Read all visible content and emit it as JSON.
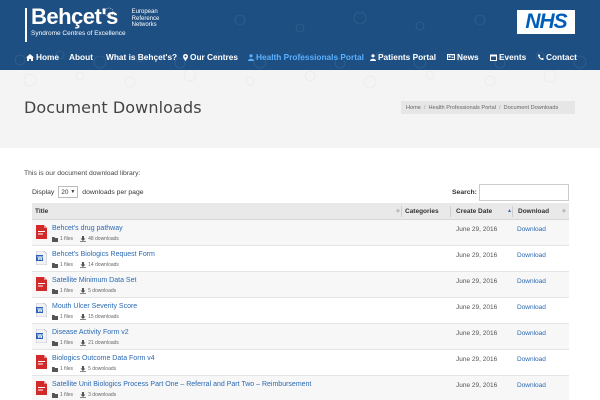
{
  "header": {
    "logo_title": "Behçet's",
    "logo_subtitle": "Syndrome Centres of Excellence",
    "logo_network": "European Reference Networks",
    "nhs_label": "NHS",
    "brand_color": "#1e4f83",
    "active_color": "#59b0ff"
  },
  "nav": {
    "items": [
      {
        "label": "Home",
        "icon": "home-icon"
      },
      {
        "label": "About",
        "icon": ""
      },
      {
        "label": "What is Behçet's?",
        "icon": ""
      },
      {
        "label": "Our Centres",
        "icon": "map-marker-icon"
      },
      {
        "label": "Health Professionals Portal",
        "icon": "user-md-icon",
        "active": true
      },
      {
        "label": "Patients Portal",
        "icon": "user-icon"
      },
      {
        "label": "News",
        "icon": "newspaper-icon"
      },
      {
        "label": "Events",
        "icon": "calendar-icon"
      },
      {
        "label": "Contact",
        "icon": "phone-icon"
      }
    ]
  },
  "page": {
    "title": "Document Downloads",
    "breadcrumb": [
      "Home",
      "Health Professionals Portal",
      "Document Downloads"
    ],
    "intro": "This is our document download library:"
  },
  "controls": {
    "display_label": "Display",
    "display_value": "20",
    "display_suffix": "downloads per page",
    "search_label": "Search:",
    "search_value": ""
  },
  "table": {
    "columns": [
      "Title",
      "Categories",
      "Create Date",
      "Download"
    ],
    "rows": [
      {
        "title": "Behcet's drug pathway",
        "files": "1 files",
        "downloads": "48 downloads",
        "date": "June 29, 2016",
        "download": "Download",
        "icon": "pdf-file-icon"
      },
      {
        "title": "Behcet's Biologics Request Form",
        "files": "1 files",
        "downloads": "14 downloads",
        "date": "June 29, 2016",
        "download": "Download",
        "icon": "word-file-icon"
      },
      {
        "title": "Satellite Minimum Data Set",
        "files": "1 files",
        "downloads": "5 downloads",
        "date": "June 29, 2016",
        "download": "Download",
        "icon": "pdf-file-icon"
      },
      {
        "title": "Mouth Ulcer Severity Score",
        "files": "1 files",
        "downloads": "15 downloads",
        "date": "June 29, 2016",
        "download": "Download",
        "icon": "word-file-icon"
      },
      {
        "title": "Disease Activity Form v2",
        "files": "1 files",
        "downloads": "21 downloads",
        "date": "June 29, 2016",
        "download": "Download",
        "icon": "word-file-icon"
      },
      {
        "title": "Biologics Outcome Data Form v4",
        "files": "1 files",
        "downloads": "5 downloads",
        "date": "June 29, 2016",
        "download": "Download",
        "icon": "pdf-file-icon"
      },
      {
        "title": "Satellite Unit Biologics Process Part One – Referral and Part Two – Reimbursement",
        "files": "1 files",
        "downloads": "3 downloads",
        "date": "June 29, 2016",
        "download": "Download",
        "icon": "pdf-file-icon"
      }
    ]
  }
}
